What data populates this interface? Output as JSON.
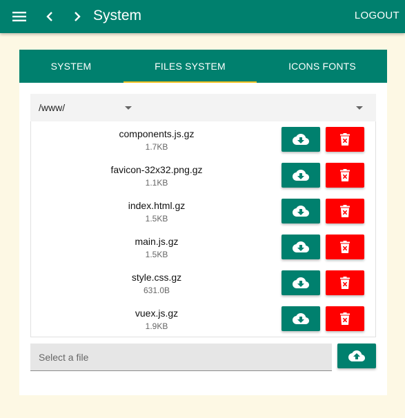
{
  "header": {
    "title": "System",
    "logout_label": "LOGOUT",
    "menu_icon": "menu-icon",
    "back_icon": "chevron-left-icon",
    "forward_icon": "chevron-right-icon"
  },
  "tabs": [
    {
      "label": "SYSTEM",
      "active": false
    },
    {
      "label": "FILES SYSTEM",
      "active": true
    },
    {
      "label": "ICONS FONTS",
      "active": false
    }
  ],
  "path_select": {
    "value": "/www/"
  },
  "files": [
    {
      "name": "components.js.gz",
      "size": "1.7KB"
    },
    {
      "name": "favicon-32x32.png.gz",
      "size": "1.1KB"
    },
    {
      "name": "index.html.gz",
      "size": "1.5KB"
    },
    {
      "name": "main.js.gz",
      "size": "1.5KB"
    },
    {
      "name": "style.css.gz",
      "size": "631.0B"
    },
    {
      "name": "vuex.js.gz",
      "size": "1.9KB"
    }
  ],
  "upload": {
    "placeholder": "Select a file"
  },
  "colors": {
    "primary": "#00806e",
    "danger": "#ff0000",
    "tab_indicator": "#f0c020",
    "page_background": "#fdf8e4"
  },
  "icons": {
    "download": "cloud-download-icon",
    "delete": "delete-icon",
    "upload": "cloud-upload-icon"
  }
}
